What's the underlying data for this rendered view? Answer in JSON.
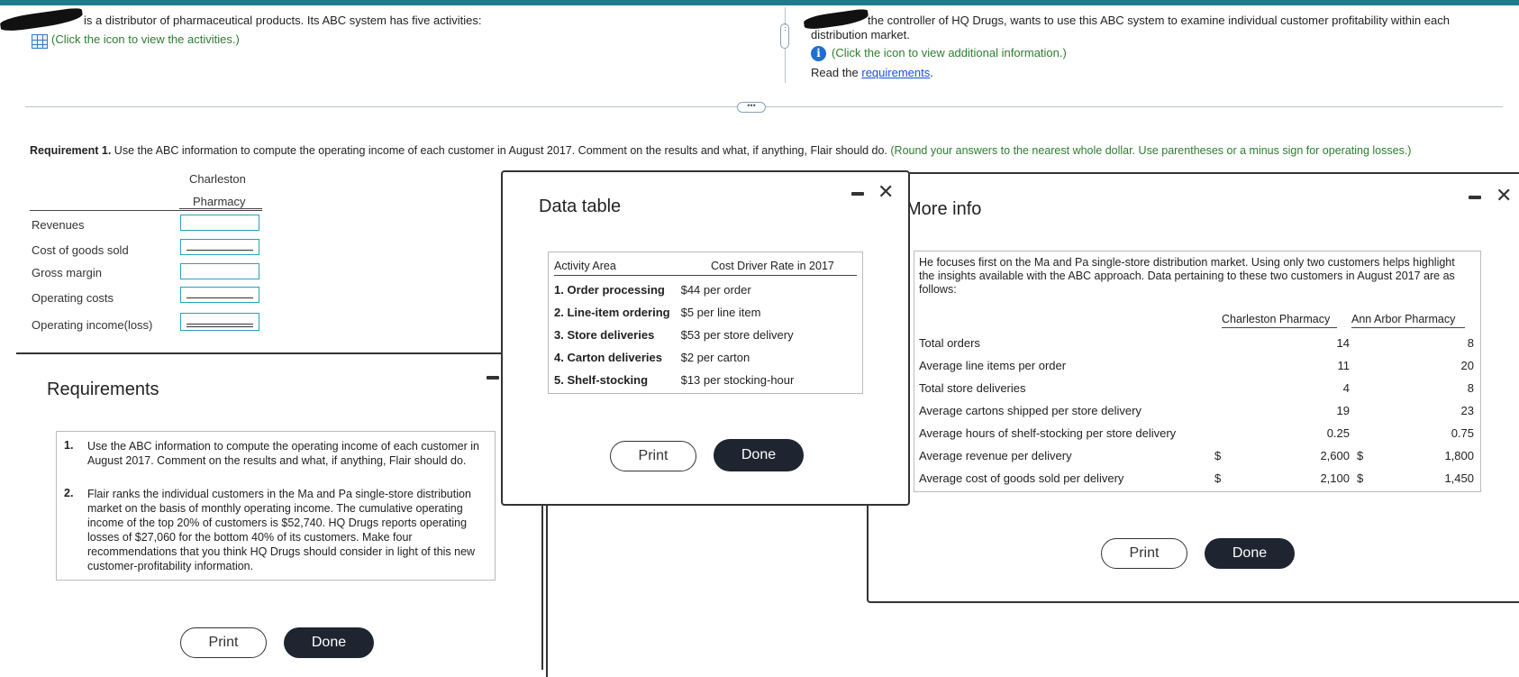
{
  "intro_left": {
    "text": "is a distributor of pharmaceutical products. Its ABC system has five activities:",
    "click_text": "(Click the icon to view the activities.)"
  },
  "intro_right": {
    "text_line1": "the controller of HQ Drugs, wants to use this ABC system to examine individual customer profitability within each",
    "text_line2": "distribution market.",
    "click_text": "(Click the icon to view additional information.)",
    "read_prefix": "Read the ",
    "read_link": "requirements",
    "read_suffix": "."
  },
  "requirement1": {
    "bold": "Requirement 1.",
    "text": " Use the ABC information to compute the operating income of each customer in August 2017. Comment on the results and what, if anything, Flair should do.",
    "hint": "(Round your answers to the nearest whole dollar. Use parentheses or a minus sign for operating losses.)"
  },
  "answer_table": {
    "col_line1": "Charleston",
    "col_line2": "Pharmacy",
    "rows": [
      "Revenues",
      "Cost of goods sold",
      "Gross margin",
      "Operating costs",
      "Operating income(loss)"
    ]
  },
  "requirements_panel": {
    "title": "Requirements",
    "items": [
      {
        "num": "1.",
        "text": "Use the ABC information to compute the operating income of each customer in August 2017. Comment on the results and what, if anything, Flair should do."
      },
      {
        "num": "2.",
        "text": "Flair ranks the individual customers in the Ma and Pa single-store distribution market on the basis of monthly operating income. The cumulative operating income of the top 20% of customers is $52,740. HQ Drugs reports operating losses of $27,060 for the bottom 40% of its customers. Make four recommendations that you think HQ Drugs should consider in light of this new customer-profitability information."
      }
    ],
    "print": "Print",
    "done": "Done"
  },
  "data_table": {
    "title": "Data table",
    "headers": [
      "Activity Area",
      "Cost Driver Rate in 2017"
    ],
    "rows": [
      {
        "num": "1.",
        "area": "Order processing",
        "rate": "$44 per order"
      },
      {
        "num": "2.",
        "area": "Line-item ordering",
        "rate": "$5 per line item"
      },
      {
        "num": "3.",
        "area": "Store deliveries",
        "rate": "$53 per store delivery"
      },
      {
        "num": "4.",
        "area": "Carton deliveries",
        "rate": "$2 per carton"
      },
      {
        "num": "5.",
        "area": "Shelf-stocking",
        "rate": "$13 per stocking-hour"
      }
    ],
    "print": "Print",
    "done": "Done"
  },
  "more_info": {
    "title": "More info",
    "paragraph": "He focuses first on the Ma and Pa single-store distribution market. Using only two customers helps highlight the insights available with the ABC approach. Data pertaining to these two customers in August 2017 are as follows:",
    "headers": [
      "Charleston Pharmacy",
      "Ann Arbor Pharmacy"
    ],
    "rows": [
      {
        "label": "Total orders",
        "cur1": "",
        "v1": "14",
        "cur2": "",
        "v2": "8"
      },
      {
        "label": "Average line items per order",
        "cur1": "",
        "v1": "11",
        "cur2": "",
        "v2": "20"
      },
      {
        "label": "Total store deliveries",
        "cur1": "",
        "v1": "4",
        "cur2": "",
        "v2": "8"
      },
      {
        "label": "Average cartons shipped per store delivery",
        "cur1": "",
        "v1": "19",
        "cur2": "",
        "v2": "23"
      },
      {
        "label": "Average hours of shelf-stocking per store delivery",
        "cur1": "",
        "v1": "0.25",
        "cur2": "",
        "v2": "0.75"
      },
      {
        "label": "Average revenue per delivery",
        "cur1": "$",
        "v1": "2,600",
        "cur2": "$",
        "v2": "1,800"
      },
      {
        "label": "Average cost of goods sold per delivery",
        "cur1": "$",
        "v1": "2,100",
        "cur2": "$",
        "v2": "1,450"
      }
    ],
    "print": "Print",
    "done": "Done"
  },
  "icons": {
    "activities": "table-grid-icon",
    "info": "info-icon"
  },
  "colors": {
    "accent_bar": "#1f7a8c",
    "hint_green": "#2e7d32",
    "input_border": "#28a0b8",
    "dark_button": "#1e2530"
  }
}
